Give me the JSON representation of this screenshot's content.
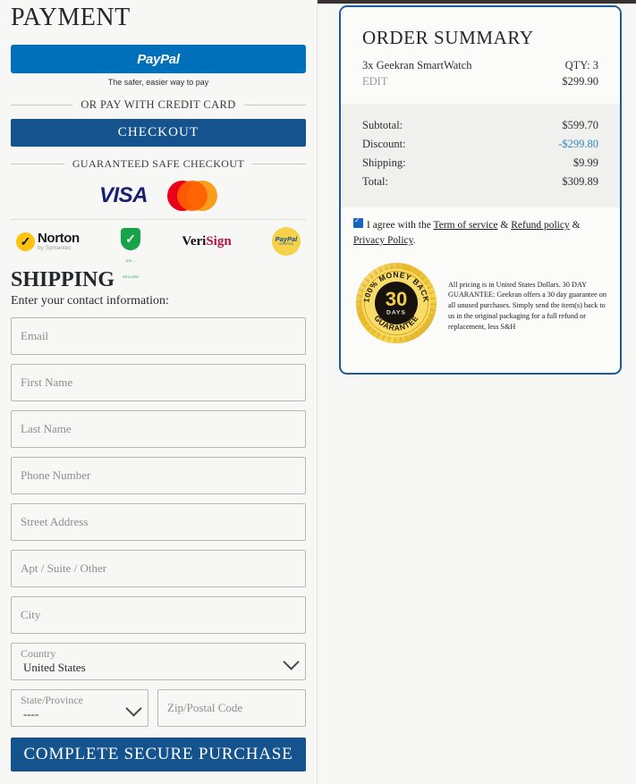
{
  "payment": {
    "heading": "PAYMENT",
    "paypal_button_label": "PayPal",
    "paypal_subtext": "The safer, easier way to pay",
    "divider_label": "OR PAY WITH CREDIT CARD",
    "checkout_button_label": "CHECKOUT",
    "safe_checkout_label": "GUARANTEED SAFE CHECKOUT",
    "cards": [
      "VISA",
      "Mastercard"
    ],
    "visa_text": "VISA",
    "trust_badges": [
      {
        "name": "Norton",
        "primary": "Norton",
        "secondary": "by Symantec"
      },
      {
        "name": "SSL Secure Shield",
        "primary": "",
        "secondary": "SSL - SECURE"
      },
      {
        "name": "VeriSign",
        "primary": "Veri",
        "secondary": "Sign"
      },
      {
        "name": "PayPal Verified",
        "primary": "PayPal",
        "secondary": "VERIFIED"
      }
    ]
  },
  "shipping": {
    "heading": "SHIPPING",
    "instruction": "Enter your contact information:",
    "fields": [
      {
        "name": "email",
        "placeholder": "Email",
        "value": ""
      },
      {
        "name": "first_name",
        "placeholder": "First Name",
        "value": ""
      },
      {
        "name": "last_name",
        "placeholder": "Last Name",
        "value": ""
      },
      {
        "name": "phone",
        "placeholder": "Phone Number",
        "value": ""
      },
      {
        "name": "street",
        "placeholder": "Street Address",
        "value": ""
      },
      {
        "name": "apt",
        "placeholder": "Apt / Suite / Other",
        "value": ""
      },
      {
        "name": "city",
        "placeholder": "City",
        "value": ""
      }
    ],
    "country": {
      "label": "Country",
      "value": "United States"
    },
    "state": {
      "label": "State/Province",
      "value": "----"
    },
    "zip": {
      "placeholder": "Zip/Postal Code",
      "value": ""
    },
    "submit_label": "COMPLETE SECURE PURCHASE"
  },
  "order_summary": {
    "title": "ORDER SUMMARY",
    "item_name": "3x Geekran SmartWatch",
    "item_qty": "QTY: 3",
    "edit_label": "EDIT",
    "item_price": "$299.90",
    "totals": [
      {
        "label": "Subtotal:",
        "value": "$599.70",
        "highlight": false
      },
      {
        "label": "Discount:",
        "value": "-$299.80",
        "highlight": true
      },
      {
        "label": "Shipping:",
        "value": "$9.99",
        "highlight": false
      },
      {
        "label": "Total:",
        "value": "$309.89",
        "highlight": false
      }
    ],
    "agree_prefix": "I agree with the",
    "link_terms": "Term of service",
    "amp1": "&",
    "link_refund": "Refund policy",
    "amp2": "&",
    "link_privacy": "Privacy Policy",
    "period": ".",
    "guarantee_badge": {
      "arc_top": "100% MONEY BACK",
      "number": "30",
      "days": "DAYS",
      "arc_bottom": "GUARANTEE"
    },
    "guarantee_text": "All pricing is in United States Dollars. 30 DAY GUARANTEE: Geekran offers a 30 day guarantee on all unused purchases. Simply send the item(s) back to us in the original packaging for a full refund or replacement, less S&H"
  },
  "colors": {
    "paypal_blue": "#0070ba",
    "checkout_navy": "#15538f",
    "summary_border": "#1c5c9e",
    "discount_blue": "#2f86c9",
    "page_bg": "#f7f7f5"
  }
}
